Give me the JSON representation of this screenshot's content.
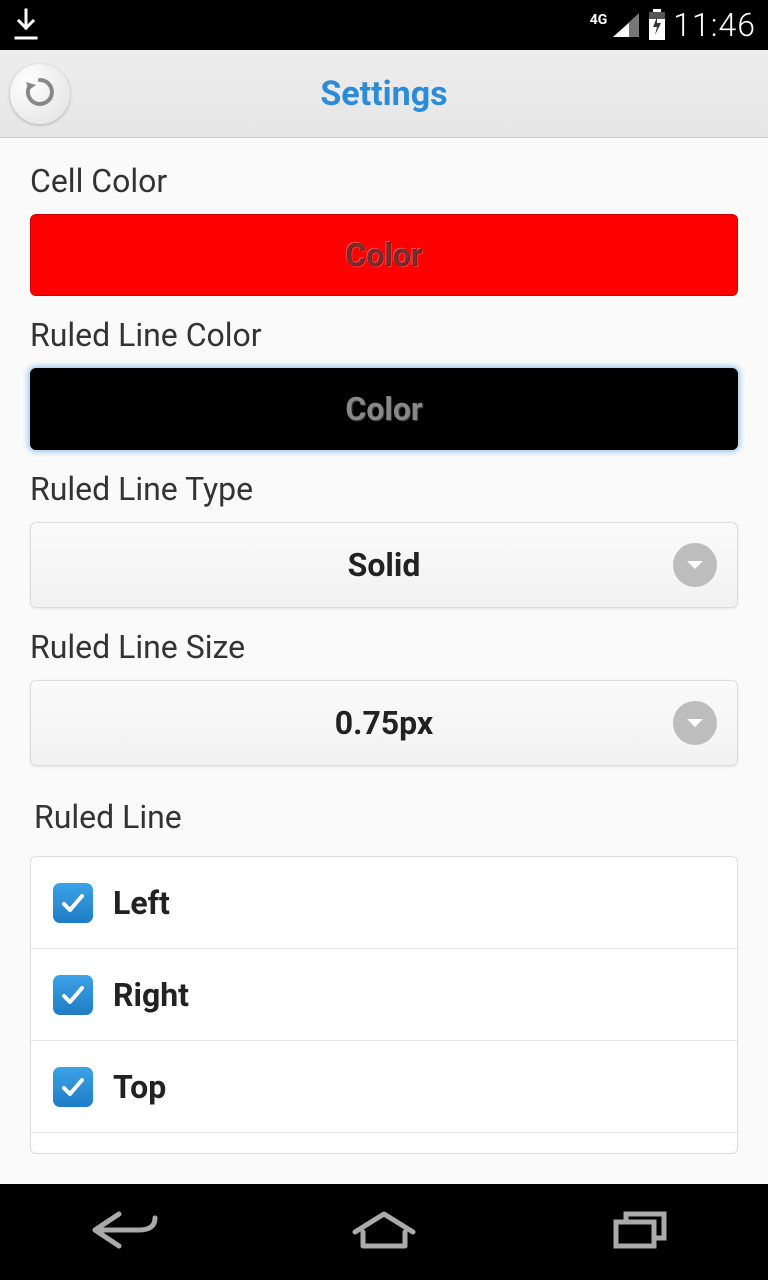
{
  "status": {
    "time": "11:46",
    "network_label": "4G"
  },
  "header": {
    "title": "Settings"
  },
  "settings": {
    "cell_color": {
      "label": "Cell Color",
      "button_text": "Color",
      "value_hex": "#ff0000"
    },
    "ruled_line_color": {
      "label": "Ruled Line Color",
      "button_text": "Color",
      "value_hex": "#000000"
    },
    "ruled_line_type": {
      "label": "Ruled Line Type",
      "value": "Solid"
    },
    "ruled_line_size": {
      "label": "Ruled Line Size",
      "value": "0.75px"
    },
    "ruled_line": {
      "label": "Ruled Line",
      "items": [
        {
          "label": "Left",
          "checked": true
        },
        {
          "label": "Right",
          "checked": true
        },
        {
          "label": "Top",
          "checked": true
        }
      ]
    }
  }
}
